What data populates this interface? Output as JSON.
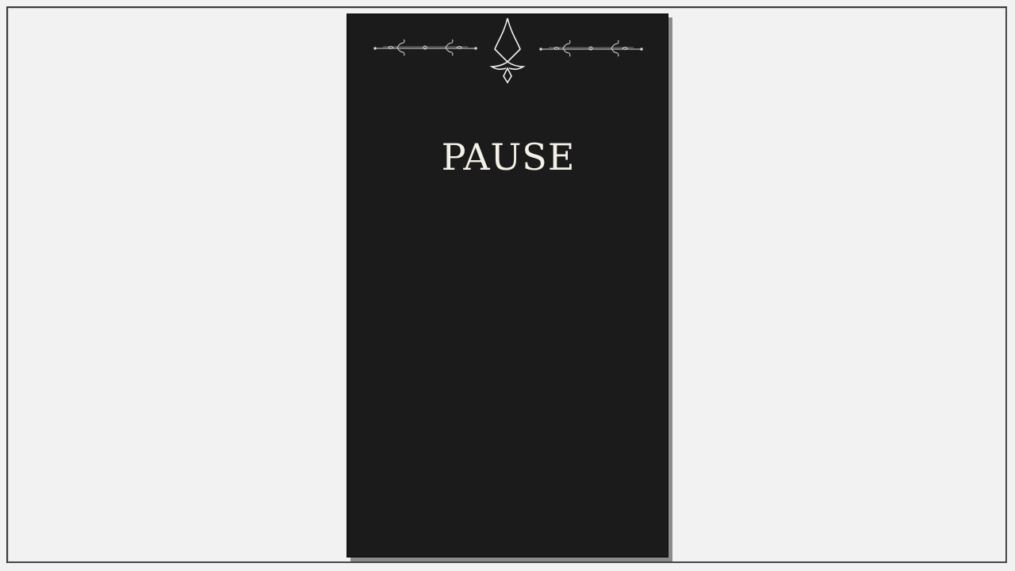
{
  "pause_menu": {
    "title": "PAUSE"
  },
  "colors": {
    "background": "#f2f2f2",
    "panel": "#1b1b1b",
    "panel_shadow": "#8c8c8c",
    "text": "#f4f1e8",
    "border": "#3a3a3a"
  }
}
